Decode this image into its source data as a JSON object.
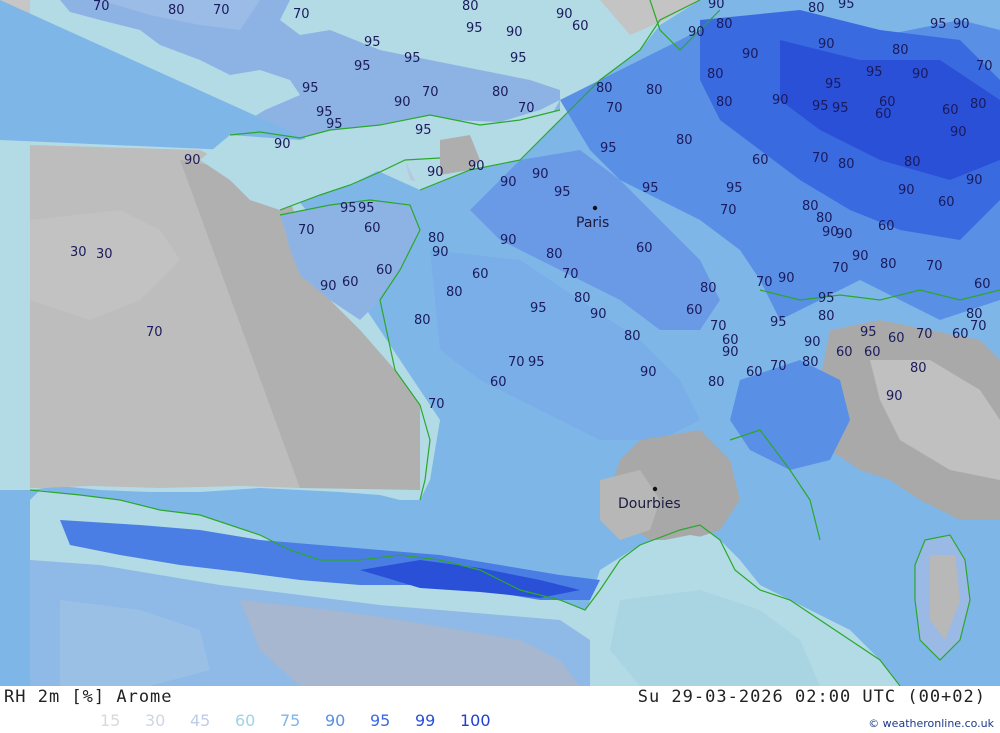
{
  "product": {
    "title": "RH 2m [%] Arome",
    "datetime": "Su 29-03-2026 02:00 UTC (00+02)",
    "credit": "© weatheronline.co.uk"
  },
  "legend": {
    "levels": [
      {
        "label": "15",
        "color": "#d9d9d9"
      },
      {
        "label": "30",
        "color": "#cdd6e6"
      },
      {
        "label": "45",
        "color": "#bccdea"
      },
      {
        "label": "60",
        "color": "#9ed3e8"
      },
      {
        "label": "75",
        "color": "#7fb6e8"
      },
      {
        "label": "90",
        "color": "#5a8fe6"
      },
      {
        "label": "95",
        "color": "#3a6ae0"
      },
      {
        "label": "99",
        "color": "#2a50d8"
      },
      {
        "label": "100",
        "color": "#1e3fd0"
      }
    ]
  },
  "cities": [
    {
      "name": "Paris"
    },
    {
      "name": "Dourbies"
    }
  ],
  "contour_labels": [
    "70",
    "80",
    "70",
    "70",
    "80",
    "90",
    "90",
    "80",
    "95",
    "95",
    "90",
    "95",
    "90",
    "60",
    "80",
    "90",
    "90",
    "80",
    "70",
    "95",
    "95",
    "95",
    "95",
    "80",
    "80",
    "80",
    "90",
    "95",
    "95",
    "90",
    "95",
    "90",
    "95",
    "95",
    "70",
    "80",
    "70",
    "70",
    "80",
    "90",
    "95",
    "95",
    "60",
    "60",
    "60",
    "80",
    "90",
    "90",
    "95",
    "90",
    "95",
    "80",
    "60",
    "70",
    "80",
    "80",
    "90",
    "90",
    "90",
    "90",
    "95",
    "95",
    "95",
    "80",
    "90",
    "70",
    "60",
    "60",
    "90",
    "90",
    "95",
    "95",
    "60",
    "70",
    "80",
    "90",
    "90",
    "80",
    "60",
    "80",
    "90",
    "90",
    "70",
    "80",
    "70",
    "60",
    "30",
    "30",
    "60",
    "60",
    "70",
    "80",
    "80",
    "95",
    "90",
    "80",
    "70",
    "90",
    "95",
    "90",
    "60",
    "80",
    "70",
    "60",
    "70",
    "95",
    "90",
    "80",
    "95",
    "60",
    "70",
    "60",
    "70",
    "80",
    "80",
    "60",
    "90",
    "70",
    "95",
    "60",
    "90",
    "80",
    "60",
    "70",
    "80",
    "60",
    "60",
    "80",
    "90",
    "70"
  ]
}
